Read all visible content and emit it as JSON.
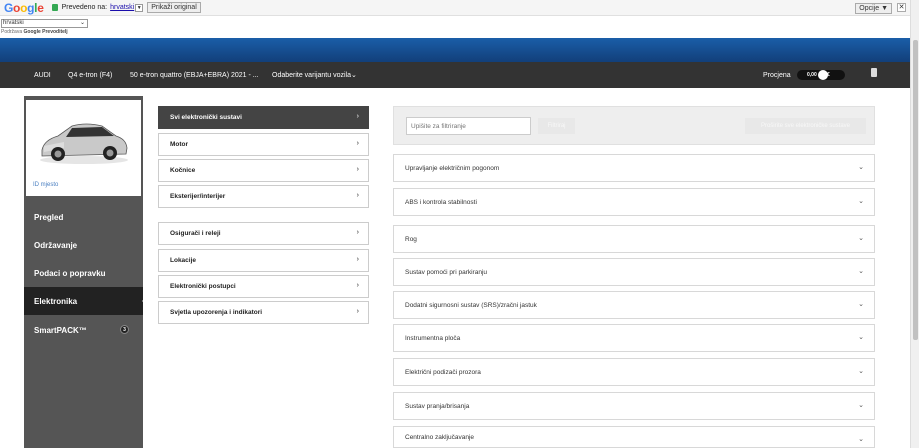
{
  "google_bar": {
    "logo_letters": [
      "G",
      "o",
      "o",
      "g",
      "l",
      "e"
    ],
    "translated_to_text": "Prevedeno na:",
    "language_link": "hrvatski",
    "dropdown_glyph": "▼",
    "show_original": "Prikaži original",
    "options": "Opcije ▼",
    "close": "✕",
    "language_select": "hrvatski",
    "select_arrow": "⌄",
    "powered_by": "Podržava",
    "powered_by_brand": "Google Prevoditelj"
  },
  "navbar": {
    "make": "AUDI",
    "model": "Q4 e-tron (F4)",
    "variant": "50 e-tron quattro (EBJA+EBRA) 2021 - ...",
    "select_variant": "Odaberite varijantu vozila⌄",
    "estimate_label": "Procjena",
    "estimate_value": "0,00",
    "currency": "€"
  },
  "vehicle": {
    "id_location": "ID mjesto"
  },
  "left_menu": [
    {
      "label": "Pregled"
    },
    {
      "label": "Održavanje"
    },
    {
      "label": "Podaci o popravku"
    },
    {
      "label": "Elektronika"
    },
    {
      "label": "SmartPACK™",
      "badge": "3"
    }
  ],
  "categories": [
    {
      "label": "Svi elektronički sustavi"
    },
    {
      "label": "Motor"
    },
    {
      "label": "Kočnice"
    },
    {
      "label": "Eksterijer/interijer"
    },
    {
      "label": "Osigurači i releji"
    },
    {
      "label": "Lokacije"
    },
    {
      "label": "Elektronički postupci"
    },
    {
      "label": "Svjetla upozorenja i indikatori"
    }
  ],
  "filter": {
    "placeholder": "Upišite za filtriranje",
    "filter_button": "Filtriraj",
    "expand_button": "Proširite sve elektroničke sustave"
  },
  "systems": [
    {
      "label": "Upravljanje električnim pogonom"
    },
    {
      "label": "ABS i kontrola stabilnosti"
    },
    {
      "label": "Rog"
    },
    {
      "label": "Sustav pomoći pri parkiranju"
    },
    {
      "label": "Dodatni sigurnosni sustav (SRS)/zračni jastuk"
    },
    {
      "label": "Instrumentna ploča"
    },
    {
      "label": "Električni podizači prozora"
    },
    {
      "label": "Sustav pranja/brisanja"
    },
    {
      "label": "Centralno zaključavanje"
    }
  ],
  "glyphs": {
    "chevron_right": "›",
    "chevron_down": "⌄"
  },
  "colors": {
    "nav_bg": "#333333",
    "brand_blue": "#1a5ea8",
    "sidebar_bg": "#555555",
    "active_item": "#444444"
  }
}
